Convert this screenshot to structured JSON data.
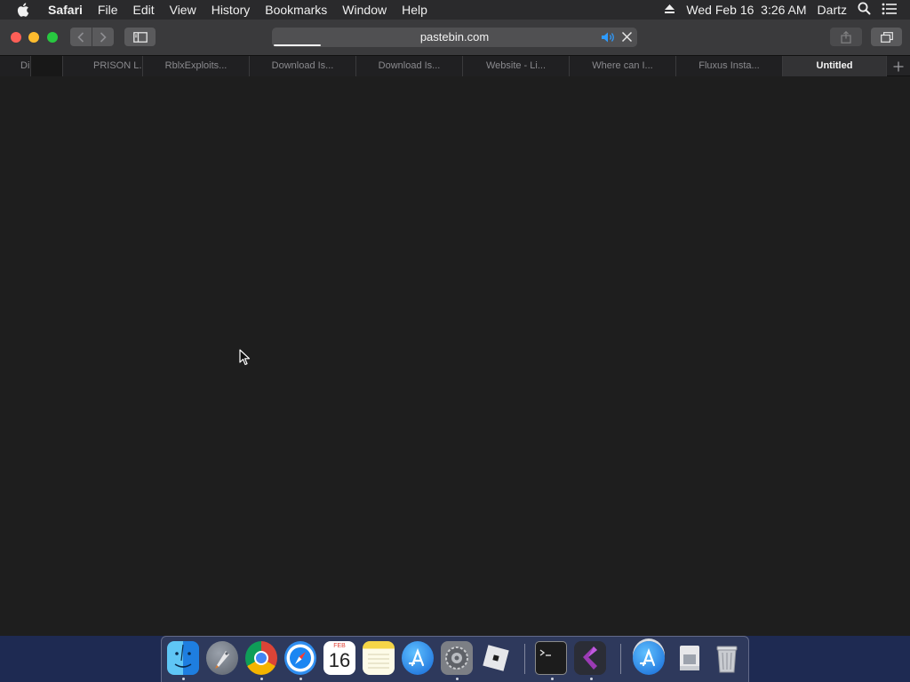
{
  "menubar": {
    "app_name": "Safari",
    "menus": [
      "File",
      "Edit",
      "View",
      "History",
      "Bookmarks",
      "Window",
      "Help"
    ],
    "clock": "Wed Feb 16  3:26 AM",
    "user": "Dartz"
  },
  "toolbar": {
    "url": "pastebin.com",
    "load_progress_percent": 13
  },
  "tabs": [
    {
      "label": "Di",
      "active": false
    },
    {
      "label": "PRISON L...",
      "active": false
    },
    {
      "label": "RblxExploits...",
      "active": false
    },
    {
      "label": "Download Is...",
      "active": false
    },
    {
      "label": "Download Is...",
      "active": false
    },
    {
      "label": "Website - Li...",
      "active": false
    },
    {
      "label": "Where can I...",
      "active": false
    },
    {
      "label": "Fluxus Insta...",
      "active": false
    },
    {
      "label": "Untitled",
      "active": true
    }
  ],
  "dock": {
    "calendar_month": "FEB",
    "calendar_day": "16",
    "apps": [
      "finder",
      "launchpad",
      "chrome",
      "safari",
      "calendar",
      "notes",
      "app-store",
      "system-preferences",
      "roblox",
      "terminal",
      "visual-studio",
      "app-store-2",
      "preview",
      "trash"
    ]
  },
  "colors": {
    "menubar": "#2a2a2c",
    "toolbar": "#3a3a3c",
    "content": "#1e1e1e",
    "close": "#fe5f57",
    "minimize": "#febc2e",
    "zoom": "#28c840",
    "desktop": "#1e2a52"
  }
}
